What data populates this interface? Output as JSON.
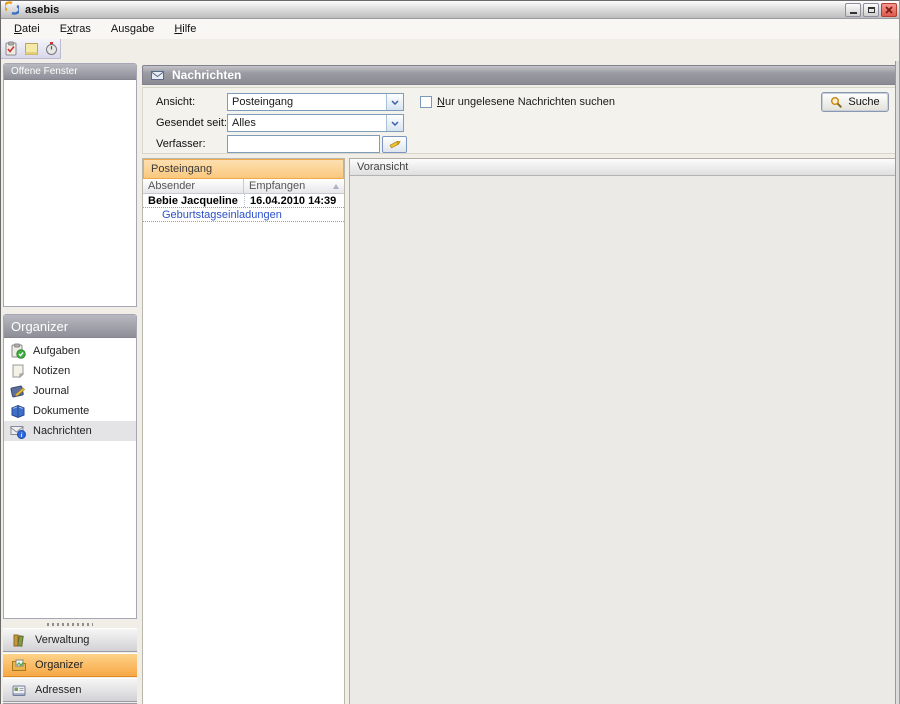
{
  "window": {
    "title": "asebis",
    "controls": {
      "minimize": "minimize",
      "restore": "restore",
      "close": "close"
    }
  },
  "menu": {
    "items": [
      {
        "pre": "",
        "key": "D",
        "post": "atei"
      },
      {
        "pre": "E",
        "key": "x",
        "post": "tras"
      },
      {
        "pre": "Ausgabe",
        "key": "",
        "post": ""
      },
      {
        "pre": "",
        "key": "H",
        "post": "ilfe"
      }
    ]
  },
  "toolbar": {
    "icons": [
      "task-edit-icon",
      "note-icon",
      "stopwatch-icon"
    ]
  },
  "sidebar": {
    "open_windows": {
      "title": "Offene Fenster",
      "items": []
    },
    "organizer": {
      "title": "Organizer",
      "items": [
        {
          "label": "Aufgaben",
          "icon": "tasks-icon",
          "selected": false
        },
        {
          "label": "Notizen",
          "icon": "notes-icon",
          "selected": false
        },
        {
          "label": "Journal",
          "icon": "journal-icon",
          "selected": false
        },
        {
          "label": "Dokumente",
          "icon": "documents-icon",
          "selected": false
        },
        {
          "label": "Nachrichten",
          "icon": "messages-icon",
          "selected": true
        }
      ]
    },
    "nav_buttons": [
      {
        "label": "Verwaltung",
        "icon": "administration-icon",
        "selected": false
      },
      {
        "label": "Organizer",
        "icon": "organizer-icon",
        "selected": true
      },
      {
        "label": "Adressen",
        "icon": "addresses-icon",
        "selected": false
      }
    ]
  },
  "main": {
    "title": "Nachrichten",
    "search": {
      "ansicht_label": "Ansicht:",
      "ansicht_value": "Posteingang",
      "gesendet_label": "Gesendet seit:",
      "gesendet_value": "Alles",
      "verfasser_label": "Verfasser:",
      "verfasser_value": "",
      "checkbox": {
        "pre": "",
        "key": "N",
        "post": "ur ungelesene Nachrichten suchen",
        "checked": false
      },
      "suche_label": "Suche"
    },
    "inbox": {
      "title": "Posteingang",
      "columns": [
        "Absender",
        "Empfangen"
      ],
      "sort": "ascending",
      "rows": [
        {
          "absender": "Bebie Jacqueline",
          "empfangen": "16.04.2010 14:39",
          "subject": "Geburtstagseinladungen"
        }
      ]
    },
    "preview": {
      "title": "Voransicht"
    }
  },
  "colors": {
    "selection_orange": "#F8A846",
    "inbox_header_orange": "#FAC87E",
    "link_blue": "#2B50C8",
    "panel_header_gray": "#8E8E98",
    "xp_border_blue": "#7F9DB9"
  }
}
